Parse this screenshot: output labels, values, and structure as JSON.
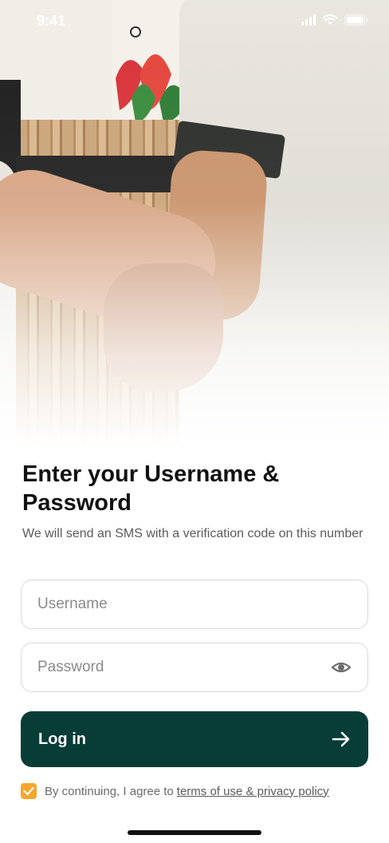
{
  "status_bar": {
    "time": "9:41",
    "icons": [
      "signal-icon",
      "wifi-icon",
      "battery-icon"
    ]
  },
  "hero": {
    "image_alt": "handshake-photo"
  },
  "heading": "Enter your Username & Password",
  "subtitle": "We will send an SMS with a verification code on this number",
  "form": {
    "username": {
      "value": "",
      "placeholder": "Username"
    },
    "password": {
      "value": "",
      "placeholder": "Password",
      "toggle_icon": "eye-icon"
    }
  },
  "login_button": {
    "label": "Log in",
    "icon": "arrow-right-icon"
  },
  "consent": {
    "checked": true,
    "text": "By continuing, I agree to",
    "link_text": "terms of use & privacy policy"
  },
  "colors": {
    "primary": "#083d37",
    "checkbox": "#f4a72c",
    "text": "#111111",
    "muted": "#5a5a5a",
    "border": "#d9d9d9"
  }
}
